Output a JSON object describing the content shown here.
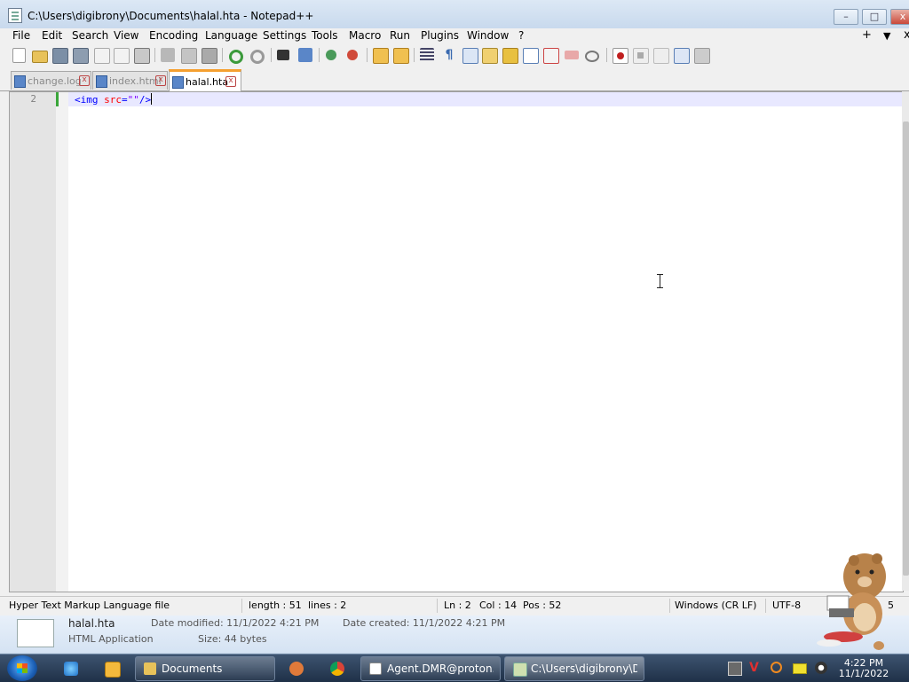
{
  "window": {
    "title": "C:\\Users\\digibrony\\Documents\\halal.hta - Notepad++",
    "controls": {
      "minimize": "–",
      "maximize": "□",
      "close": "x"
    }
  },
  "menu": {
    "items": [
      "File",
      "Edit",
      "Search",
      "View",
      "Encoding",
      "Language",
      "Settings",
      "Tools",
      "Macro",
      "Run",
      "Plugins",
      "Window",
      "?"
    ],
    "right": {
      "plus": "+",
      "dropdown": "▼",
      "close": "x"
    }
  },
  "toolbar": {
    "icons": [
      "new-file",
      "open-file",
      "save",
      "save-all",
      "close",
      "close-all",
      "print",
      "cut",
      "copy",
      "paste",
      "undo",
      "redo",
      "find",
      "replace",
      "zoom-in",
      "zoom-out",
      "sync-vertical",
      "sync-horizontal",
      "word-wrap",
      "show-all-chars",
      "indent-guide",
      "user-defined-language",
      "document-map",
      "function-list",
      "folder-as-workspace",
      "monitoring",
      "preview",
      "record-macro",
      "stop-recording",
      "play-macro",
      "run-macro-multiple",
      "save-macro"
    ]
  },
  "tabs": [
    {
      "label": "change.log",
      "active": false
    },
    {
      "label": "index.html",
      "active": false
    },
    {
      "label": "halal.hta",
      "active": true
    }
  ],
  "editor": {
    "line_number": "2",
    "code": {
      "open": "<img",
      "attr": "src",
      "eq": "=",
      "value": "\"\"",
      "close": "/>"
    }
  },
  "statusbar": {
    "file_type": "Hyper Text Markup Language file",
    "length": "length : 51",
    "lines": "lines : 2",
    "ln": "Ln : 2",
    "col": "Col : 14",
    "pos": "Pos : 52",
    "eol": "Windows (CR LF)",
    "encoding": "UTF-8",
    "ins": "5"
  },
  "details_pane": {
    "filename": "halal.hta",
    "type": "HTML Application",
    "date_modified": "Date modified: 11/1/2022 4:21 PM",
    "date_created": "Date created: 11/1/2022 4:21 PM",
    "size": "Size: 44 bytes"
  },
  "taskbar": {
    "buttons": [
      {
        "label": "Documents"
      },
      {
        "label": "Agent.DMR@proton..."
      },
      {
        "label": "C:\\Users\\digibrony\\D..."
      }
    ],
    "clock": {
      "time": "4:22 PM",
      "date": "11/1/2022"
    }
  },
  "colors": {
    "tag": "#0000ff",
    "attr": "#ff0000",
    "string": "#8000ff",
    "active_tab_accent": "#f5a030"
  }
}
